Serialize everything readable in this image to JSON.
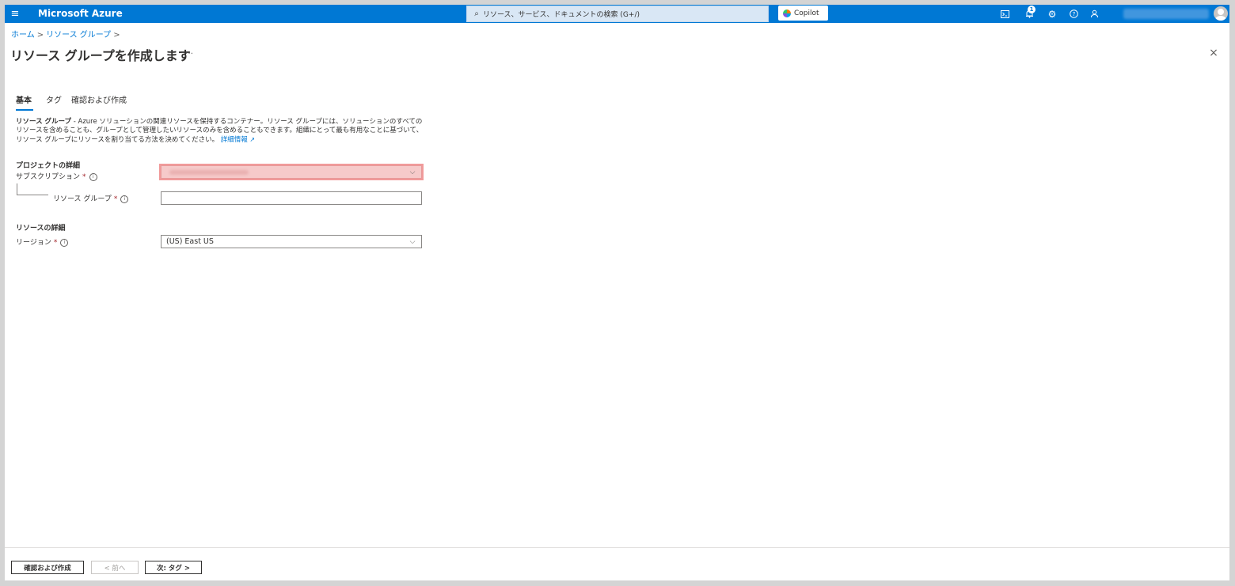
{
  "topbar": {
    "menu_icon": "hamburger-icon",
    "brand": "Microsoft Azure",
    "search_placeholder": "リソース、サービス、ドキュメントの検索 (G+/)",
    "copilot_label": "Copilot",
    "notification_count": "1",
    "icons": [
      "cloud-shell-icon",
      "bell-icon",
      "gear-icon",
      "help-icon",
      "feedback-icon",
      "avatar-icon"
    ]
  },
  "breadcrumb": {
    "home": "ホーム",
    "resource_groups": "リソース グループ",
    "separator": ">"
  },
  "page": {
    "title": "リソース グループを作成します",
    "more": "…",
    "close": "×"
  },
  "tabs": [
    {
      "label": "基本",
      "selected": true
    },
    {
      "label": "タグ",
      "selected": false
    },
    {
      "label": "確認および作成",
      "selected": false
    }
  ],
  "description": {
    "bold": "リソース グループ",
    "text": " - Azure ソリューションの関連リソースを保持するコンテナー。リソース グループには、ソリューションのすべてのリソースを含めることも、グループとして管理したいリソースのみを含めることもできます。組織にとって最も有用なことに基づいて、リソース グループにリソースを割り当てる方法を決めてください。",
    "link": "詳細情報",
    "link_icon": "external-link-icon"
  },
  "project": {
    "heading": "プロジェクトの詳細",
    "subscription_label": "サブスクリプション",
    "required_mark": "*",
    "resource_group_label": "リソース グループ",
    "resource_group_value": ""
  },
  "resource": {
    "heading": "リソースの詳細",
    "region_label": "リージョン",
    "region_value": "(US) East US"
  },
  "footer": {
    "review_create": "確認および作成",
    "previous": "< 前へ",
    "next": "次: タグ >"
  },
  "colors": {
    "azure_blue": "#0078d4",
    "highlight_border": "#f19a9a",
    "required": "#a4262c"
  }
}
